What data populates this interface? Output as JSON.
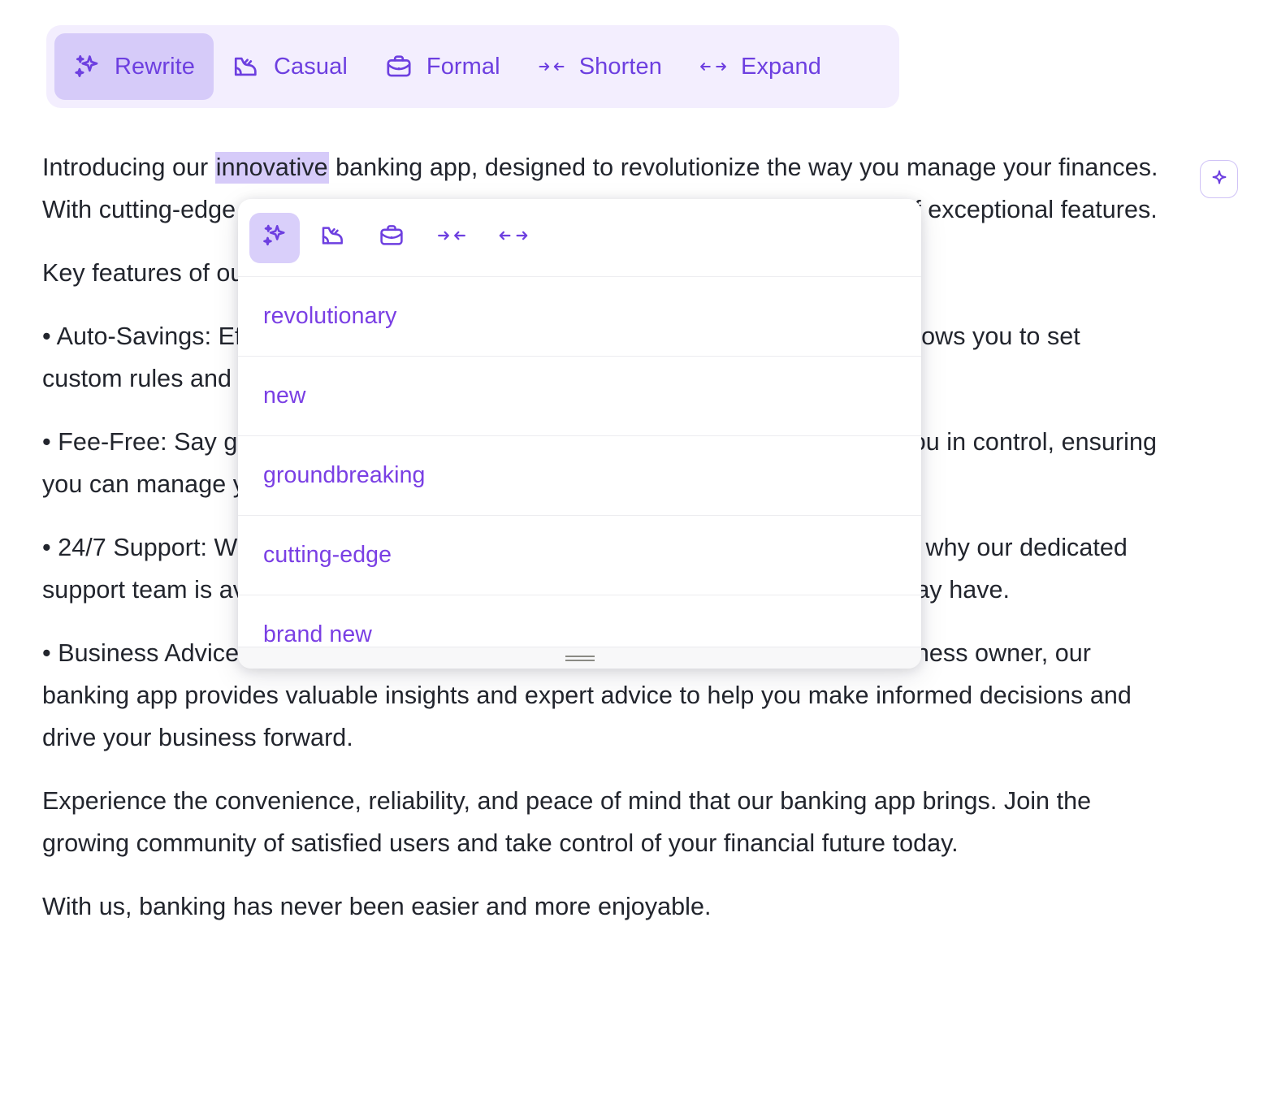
{
  "toolbar": {
    "items": [
      {
        "label": "Rewrite",
        "icon": "sparkles-icon",
        "active": true
      },
      {
        "label": "Casual",
        "icon": "boot-icon",
        "active": false
      },
      {
        "label": "Formal",
        "icon": "briefcase-icon",
        "active": false
      },
      {
        "label": "Shorten",
        "icon": "arrows-in-icon",
        "active": false
      },
      {
        "label": "Expand",
        "icon": "arrows-out-icon",
        "active": false
      }
    ]
  },
  "document": {
    "paragraphs": [
      {
        "before": "Introducing our ",
        "highlight": "innovative",
        "after": " banking app, designed to revolutionize the way you manage your finances. With cutting-edge technology and user-friendly design, our app offers a range of exceptional features."
      },
      {
        "text": "Key features of our banking app include:"
      },
      {
        "text": "• Auto-Savings: Effortlessly save money with our Auto-Savings feature, which allows you to set custom rules and watch your savings grow without lifting a finger."
      },
      {
        "text": "• Fee-Free: Say goodbye to unnecessary fees! Our fee-free banking app puts you in control, ensuring you can manage your money without worrying about exorbitant costs."
      },
      {
        "text": "• 24/7 Support: We understand that banking issues can arise at any time. That's why our dedicated support team is available 24/7 to assist you with any queries or concerns you may have."
      },
      {
        "text": "• Business Advice: Whether you're an aspiring entrepreneur or a seasoned business owner, our banking app provides valuable insights and expert advice to help you make informed decisions and drive your business forward."
      },
      {
        "text": "Experience the convenience, reliability, and peace of mind that our banking app brings. Join the growing community of satisfied users and take control of your financial future today."
      },
      {
        "text": " With us, banking has never been easier and more enjoyable."
      }
    ]
  },
  "popup": {
    "tools": [
      {
        "icon": "sparkles-icon",
        "active": true
      },
      {
        "icon": "boot-icon",
        "active": false
      },
      {
        "icon": "briefcase-icon",
        "active": false
      },
      {
        "icon": "arrows-in-icon",
        "active": false
      },
      {
        "icon": "arrows-out-icon",
        "active": false
      }
    ],
    "suggestions": [
      {
        "label": "revolutionary"
      },
      {
        "label": "new"
      },
      {
        "label": "groundbreaking"
      },
      {
        "label": "cutting-edge"
      },
      {
        "label": "brand new"
      }
    ]
  },
  "floating_button": {
    "icon": "sparkle-star-icon"
  },
  "colors": {
    "accent": "#6d3fe0",
    "suggestion_text": "#7a3fe4",
    "toolbar_bg": "#f3eefe",
    "active_chip": "#d6cbf9",
    "body_text": "#22252d",
    "highlight_bg": "#d6cbf9"
  }
}
